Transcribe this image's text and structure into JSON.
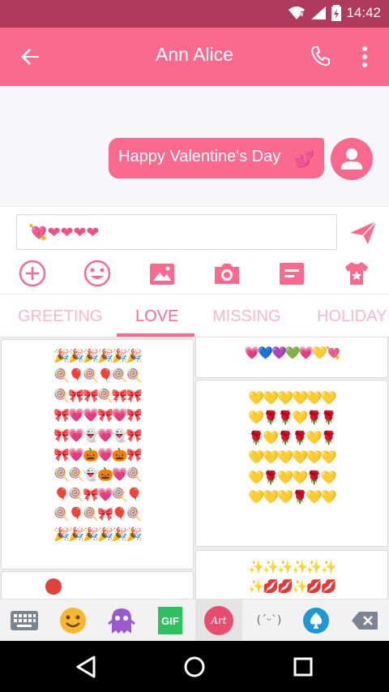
{
  "status": {
    "time": "14:42"
  },
  "appbar": {
    "title": "Ann Alice",
    "back_icon": "arrow-back-icon",
    "phone_icon": "phone-icon",
    "more_icon": "more-vert-icon"
  },
  "chat": {
    "message": "Happy Valentine's Day",
    "message_emoji": "💕",
    "accent": "#fb6a8e"
  },
  "compose": {
    "input_value": "💘❤❤❤❤",
    "tools": [
      "add-icon",
      "emoji-icon",
      "image-icon",
      "camera-icon",
      "template-icon",
      "theme-icon"
    ]
  },
  "tabs": [
    {
      "label": "GREETING"
    },
    {
      "label": "LOVE"
    },
    {
      "label": "MISSING"
    },
    {
      "label": "HOLIDAY"
    }
  ],
  "art": {
    "left_main": "🎉🎉🎉🎉🎉🎉\n🍭🎈🍭🎈🍭🍭\n🍭🎀🎀🍭🎀🎀\n🎀💗💗🎀💗🎀\n🎀💗👻💗👻🎀\n🎀💗🎃💗🎃🎀\n🍭🍭👻🎃💗🍭\n🎈🍭🎀💗🍭🎈\n🍭🎈🍭🎀🎈🍭\n🎉🎉🎉🎉🎉🎉",
    "right_top": "💗💙💜💚💗💛💘",
    "right_mid": "💛💛💛💛💛💛\n💛🌹🌹💛🌹🌹\n🌹💛🌹🌹💛🌹\n💛💛💛💛💛💛\n💛🌹💛💛🌹💛\n💛💛💛🌹💛💛",
    "right_bottom": "✨✨✨✨✨✨\n✨💋💋✨💋💋"
  },
  "keyboard": {
    "gif_label": "GIF",
    "art_label": "Art",
    "kaomoji_label": "(ˊᵕˋ)"
  }
}
